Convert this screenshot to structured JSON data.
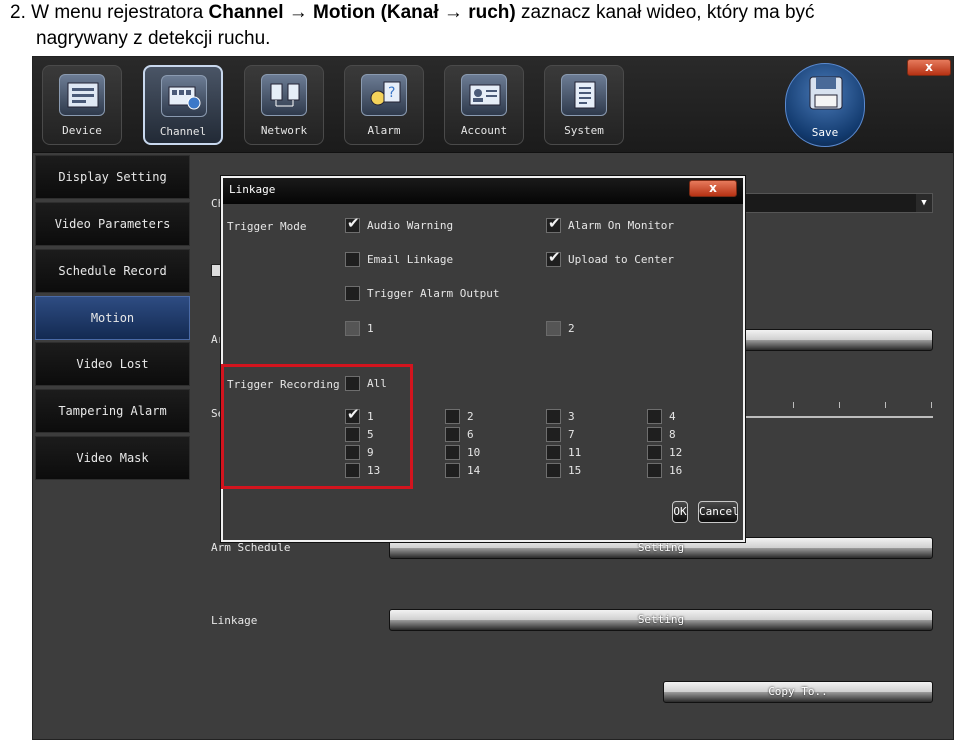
{
  "doc": {
    "line1_prefix": "2. W menu rejestratora ",
    "line1_bold": "Channel → Motion (Kanał → ruch)",
    "line1_suffix": " zaznacz kanał wideo, który ma być",
    "line2": "nagrywany z detekcji ruchu."
  },
  "top_tabs": [
    {
      "label": "Device",
      "icon": "device-icon"
    },
    {
      "label": "Channel",
      "icon": "channel-icon",
      "active": true
    },
    {
      "label": "Network",
      "icon": "network-icon"
    },
    {
      "label": "Alarm",
      "icon": "alarm-icon"
    },
    {
      "label": "Account",
      "icon": "account-icon"
    },
    {
      "label": "System",
      "icon": "system-icon"
    }
  ],
  "save_label": "Save",
  "window_close": "x",
  "sidebar": [
    {
      "label": "Display Setting"
    },
    {
      "label": "Video Parameters"
    },
    {
      "label": "Schedule Record"
    },
    {
      "label": "Motion",
      "active": true
    },
    {
      "label": "Video Lost"
    },
    {
      "label": "Tampering Alarm"
    },
    {
      "label": "Video Mask"
    }
  ],
  "main": {
    "channel_label_partial": "Ch",
    "arm_label_partial": "Ar",
    "sensitivity_label_partial": "Se",
    "arm_schedule_label": "Arm Schedule",
    "arm_schedule_button": "Setting",
    "linkage_label": "Linkage",
    "linkage_button": "Setting",
    "copy_button": "Copy To.."
  },
  "dialog": {
    "title": "Linkage",
    "close": "x",
    "trigger_mode_label": "Trigger Mode",
    "options": {
      "audio_warning": {
        "label": "Audio Warning",
        "checked": true
      },
      "alarm_on_monitor": {
        "label": "Alarm On Monitor",
        "checked": true
      },
      "email_linkage": {
        "label": "Email Linkage",
        "checked": false
      },
      "upload_to_center": {
        "label": "Upload to Center",
        "checked": true
      },
      "trigger_alarm_output": {
        "label": "Trigger Alarm Output",
        "checked": false
      }
    },
    "alarm_outputs": [
      {
        "label": "1",
        "disabled": true
      },
      {
        "label": "2",
        "disabled": true
      }
    ],
    "trigger_recording_label": "Trigger Recording",
    "all_label": "All",
    "all_checked": false,
    "channels": [
      {
        "label": "1",
        "checked": true
      },
      {
        "label": "2"
      },
      {
        "label": "3"
      },
      {
        "label": "4"
      },
      {
        "label": "5"
      },
      {
        "label": "6"
      },
      {
        "label": "7"
      },
      {
        "label": "8"
      },
      {
        "label": "9"
      },
      {
        "label": "10"
      },
      {
        "label": "11"
      },
      {
        "label": "12"
      },
      {
        "label": "13"
      },
      {
        "label": "14"
      },
      {
        "label": "15"
      },
      {
        "label": "16"
      }
    ],
    "ok_label": "OK",
    "cancel_label": "Cancel"
  },
  "colors": {
    "highlight": "#d3141e",
    "active_sidebar": "#2e4c82",
    "close_button": "#c84a2a"
  }
}
